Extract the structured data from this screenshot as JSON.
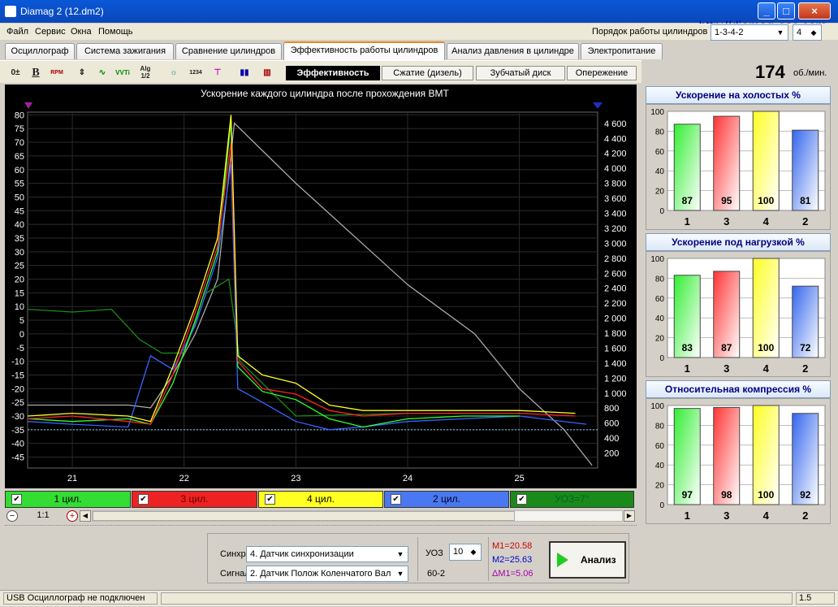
{
  "window": {
    "title": "Diamag 2 (12.dm2)",
    "url": "http://diamag-osc.com",
    "minimize": "_",
    "maximize": "□",
    "close": "×"
  },
  "menu": [
    "Файл",
    "Сервис",
    "Окна",
    "Помощь"
  ],
  "firing_order": {
    "label": "Порядок работы цилиндров",
    "value": "1-3-4-2",
    "cyl_value": "4"
  },
  "tabs": [
    "Осциллограф",
    "Система зажигания",
    "Сравнение цилиндров",
    "Эффективность работы цилиндров",
    "Анализ давления в цилиндре",
    "Электропитание"
  ],
  "active_tab": 3,
  "toolbar": {
    "icons": [
      "zoom-v-icon",
      "bold-b-icon",
      "rpm-icon",
      "scale-icon",
      "smooth-icon",
      "vvti-icon",
      "alg-icon",
      "sensor-icon",
      "t234-icon",
      "filter-icon",
      "colorbars-icon",
      "chart-icon"
    ],
    "labels": {
      "b": "B",
      "rpm": "RPM",
      "vvti": "VVTi",
      "alg": "Alg 1/2",
      "t": "1234"
    }
  },
  "subtabs": [
    "Эффективность",
    "Сжатие (дизель)",
    "Зубчатый диск",
    "Опережение"
  ],
  "active_subtab": 0,
  "rpm": {
    "value": "174",
    "unit": "об./мин."
  },
  "chart_data": {
    "type": "line",
    "title": "Ускорение каждого цилиндра после прохождения ВМТ",
    "x_ticks": [
      "21",
      "22",
      "23",
      "24",
      "25"
    ],
    "xlim": [
      20.6,
      25.7
    ],
    "left_y": {
      "ylim": [
        -49,
        81
      ],
      "ticks": [
        "80",
        "75",
        "70",
        "65",
        "60",
        "55",
        "50",
        "45",
        "40",
        "35",
        "30",
        "25",
        "20",
        "15",
        "10",
        "5",
        "0",
        "-5",
        "-10",
        "-15",
        "-20",
        "-25",
        "-30",
        "-35",
        "-40",
        "-45"
      ]
    },
    "right_y": {
      "ylim": [
        0,
        4750
      ],
      "ticks": [
        "4 600",
        "4 400",
        "4 200",
        "4 000",
        "3 800",
        "3 600",
        "3 400",
        "3 200",
        "3 000",
        "2 800",
        "2 600",
        "2 400",
        "2 200",
        "2 000",
        "1 800",
        "1 600",
        "1 400",
        "1 200",
        "1 000",
        "800",
        "600",
        "400",
        "200"
      ]
    },
    "series": [
      {
        "name": "1 цил.",
        "color": "#33ff33",
        "x": [
          20.6,
          21.0,
          21.5,
          21.7,
          21.9,
          22.1,
          22.3,
          22.42,
          22.48,
          22.7,
          23.0,
          23.3,
          23.6,
          24.0,
          24.5,
          25.0
        ],
        "y": [
          -31,
          -32,
          -31,
          -33,
          -18,
          5,
          30,
          78,
          -12,
          -21,
          -24,
          -31,
          -34,
          -31,
          -30,
          -30
        ]
      },
      {
        "name": "3 цил.",
        "color": "#ff2222",
        "x": [
          20.6,
          21.0,
          21.5,
          21.7,
          21.9,
          22.1,
          22.3,
          22.42,
          22.48,
          22.7,
          23.0,
          23.3,
          23.6,
          24.0,
          24.5,
          25.0,
          25.5
        ],
        "y": [
          -31,
          -30,
          -32,
          -33,
          -15,
          8,
          32,
          70,
          -10,
          -20,
          -22,
          -28,
          -30,
          -29,
          -29,
          -29,
          -30
        ]
      },
      {
        "name": "4 цил.",
        "color": "#ffff22",
        "x": [
          20.6,
          21.0,
          21.5,
          21.7,
          21.9,
          22.1,
          22.3,
          22.42,
          22.48,
          22.7,
          23.0,
          23.3,
          23.6,
          24.0,
          24.5,
          25.0,
          25.5
        ],
        "y": [
          -30,
          -29,
          -30,
          -32,
          -12,
          10,
          35,
          80,
          -8,
          -15,
          -18,
          -26,
          -28,
          -28,
          -28,
          -28,
          -29
        ]
      },
      {
        "name": "2 цил.",
        "color": "#3366ff",
        "x": [
          20.6,
          21.0,
          21.5,
          21.7,
          21.9,
          22.1,
          22.3,
          22.42,
          22.48,
          22.7,
          23.0,
          23.3,
          23.6,
          24.0,
          24.5,
          25.0,
          25.6
        ],
        "y": [
          -32,
          -33,
          -34,
          -8,
          -13,
          3,
          28,
          62,
          -20,
          -25,
          -32,
          -35,
          -34,
          -32,
          -31,
          -30,
          -33
        ]
      },
      {
        "name": "УОЗ=7°",
        "color": "#1a8a1a",
        "x": [
          20.6,
          21.0,
          21.35,
          21.6,
          21.8,
          22.0,
          22.2,
          22.4,
          22.5,
          23.0,
          24.0,
          25.0
        ],
        "y": [
          9,
          8,
          9,
          -2,
          -7,
          -7,
          15,
          20,
          -10,
          -30,
          -29,
          -29
        ]
      },
      {
        "name": "",
        "color": "#aaaaaa",
        "x": [
          20.6,
          21.5,
          21.7,
          21.9,
          22.1,
          22.3,
          22.45,
          23.0,
          24.0,
          24.6,
          25.0,
          25.4,
          25.65
        ],
        "y": [
          -26,
          -26,
          -27,
          -15,
          0,
          20,
          77,
          55,
          18,
          0,
          -20,
          -35,
          -48
        ]
      }
    ]
  },
  "legend_scroll": {
    "zoom": "1:1"
  },
  "side": {
    "panels": [
      {
        "title": "Ускорение на холостых %",
        "ticks": [
          "100",
          "80",
          "60",
          "40",
          "20",
          "0"
        ],
        "bars": [
          {
            "cyl": "1",
            "value": 87,
            "color": "#33ee33"
          },
          {
            "cyl": "3",
            "value": 95,
            "color": "#ff3333"
          },
          {
            "cyl": "4",
            "value": 100,
            "color": "#ffff22"
          },
          {
            "cyl": "2",
            "value": 81,
            "color": "#3366ee"
          }
        ]
      },
      {
        "title": "Ускорение под нагрузкой %",
        "ticks": [
          "100",
          "80",
          "60",
          "40",
          "20",
          "0"
        ],
        "bars": [
          {
            "cyl": "1",
            "value": 83,
            "color": "#33ee33"
          },
          {
            "cyl": "3",
            "value": 87,
            "color": "#ff3333"
          },
          {
            "cyl": "4",
            "value": 100,
            "color": "#ffff22"
          },
          {
            "cyl": "2",
            "value": 72,
            "color": "#3366ee"
          }
        ]
      },
      {
        "title": "Относительная компрессия %",
        "ticks": [
          "100",
          "80",
          "60",
          "40",
          "20",
          "0"
        ],
        "bars": [
          {
            "cyl": "1",
            "value": 97,
            "color": "#33ee33"
          },
          {
            "cyl": "3",
            "value": 98,
            "color": "#ff3333"
          },
          {
            "cyl": "4",
            "value": 100,
            "color": "#ffff22"
          },
          {
            "cyl": "2",
            "value": 92,
            "color": "#3366ee"
          }
        ]
      }
    ]
  },
  "bottom": {
    "sync_label": "Синхро:",
    "sync_value": "4.  Датчик синхронизации",
    "signal_label": "Сигнал:",
    "signal_value": "2.  Датчик Полож Коленчатого Вал",
    "uoz_label": "УОЗ",
    "uoz_value": "10",
    "teeth": "60-2",
    "m1": "M1=20.58",
    "m2": "M2=25.63",
    "dm1": "ΔM1=5.06",
    "analyze_label": "Анализ"
  },
  "status": {
    "left": "USB Осциллограф не подключен",
    "right": "1.5"
  }
}
